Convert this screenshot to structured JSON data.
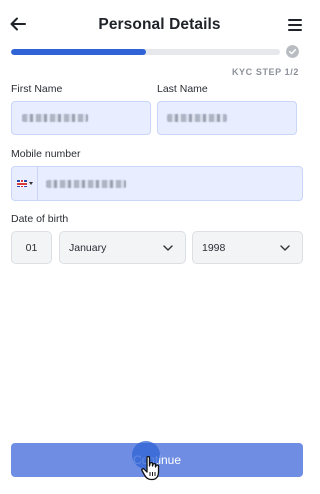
{
  "header": {
    "title": "Personal Details",
    "back_icon": "arrow-left-icon",
    "menu_icon": "hamburger-menu-icon"
  },
  "progress": {
    "fraction": 0.5,
    "step_label": "KYC STEP 1/2",
    "complete_icon": "check-circle-icon"
  },
  "form": {
    "first_name": {
      "label": "First Name"
    },
    "last_name": {
      "label": "Last Name"
    },
    "mobile": {
      "label": "Mobile number",
      "country_icon": "uk-flag-icon"
    },
    "dob": {
      "label": "Date of birth",
      "day": "01",
      "month": "January",
      "year": "1998"
    }
  },
  "continue_button": {
    "label": "Continue"
  },
  "colors": {
    "accent": "#2f63d6",
    "field_bg": "#e8eeff",
    "button_bg": "#6f8ee3"
  }
}
